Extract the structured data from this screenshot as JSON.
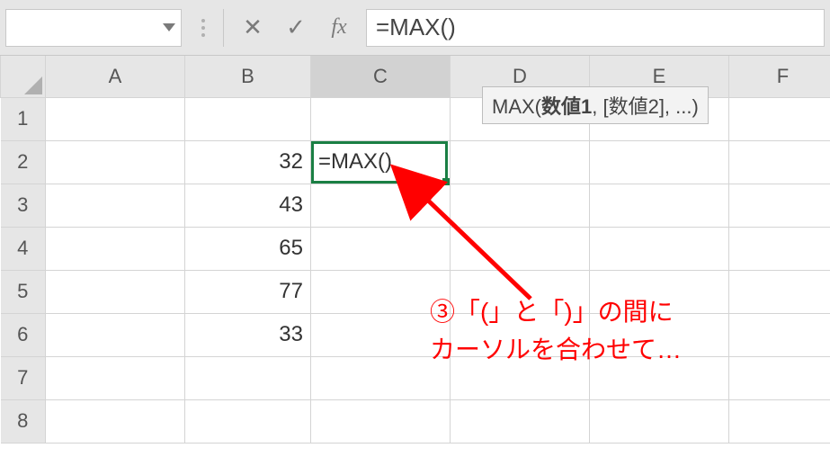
{
  "formula_bar": {
    "name_box_value": "",
    "cancel_glyph": "✕",
    "confirm_glyph": "✓",
    "fx_label": "fx",
    "formula_text": "=MAX()"
  },
  "columns": [
    "A",
    "B",
    "C",
    "D",
    "E",
    "F"
  ],
  "rows": [
    "1",
    "2",
    "3",
    "4",
    "5",
    "6",
    "7",
    "8"
  ],
  "cells": {
    "B2": "32",
    "B3": "43",
    "B4": "65",
    "B5": "77",
    "B6": "33",
    "C2": "=MAX()"
  },
  "active_cell": "C2",
  "fn_tooltip": {
    "fn_name": "MAX(",
    "arg1": "数値1",
    "rest": ", [数値2], ...)"
  },
  "annotation": {
    "line1": "③「(」と「)」の間に",
    "line2": "カーソルを合わせて…"
  },
  "colors": {
    "accent": "#1a7f44",
    "annotation": "#ff0000",
    "header_bg": "#e6e6e6"
  },
  "chart_data": {
    "type": "table",
    "columns": [
      "A",
      "B",
      "C",
      "D",
      "E",
      "F"
    ],
    "data_rows": [
      {
        "row": 1,
        "A": "",
        "B": "",
        "C": "",
        "D": "",
        "E": "",
        "F": ""
      },
      {
        "row": 2,
        "A": "",
        "B": 32,
        "C": "=MAX()",
        "D": "",
        "E": "",
        "F": ""
      },
      {
        "row": 3,
        "A": "",
        "B": 43,
        "C": "",
        "D": "",
        "E": "",
        "F": ""
      },
      {
        "row": 4,
        "A": "",
        "B": 65,
        "C": "",
        "D": "",
        "E": "",
        "F": ""
      },
      {
        "row": 5,
        "A": "",
        "B": 77,
        "C": "",
        "D": "",
        "E": "",
        "F": ""
      },
      {
        "row": 6,
        "A": "",
        "B": 33,
        "C": "",
        "D": "",
        "E": "",
        "F": ""
      },
      {
        "row": 7,
        "A": "",
        "B": "",
        "C": "",
        "D": "",
        "E": "",
        "F": ""
      },
      {
        "row": 8,
        "A": "",
        "B": "",
        "C": "",
        "D": "",
        "E": "",
        "F": ""
      }
    ],
    "formula_bar": "=MAX()",
    "active_cell": "C2",
    "tooltip": "MAX(数値1, [数値2], ...)"
  }
}
